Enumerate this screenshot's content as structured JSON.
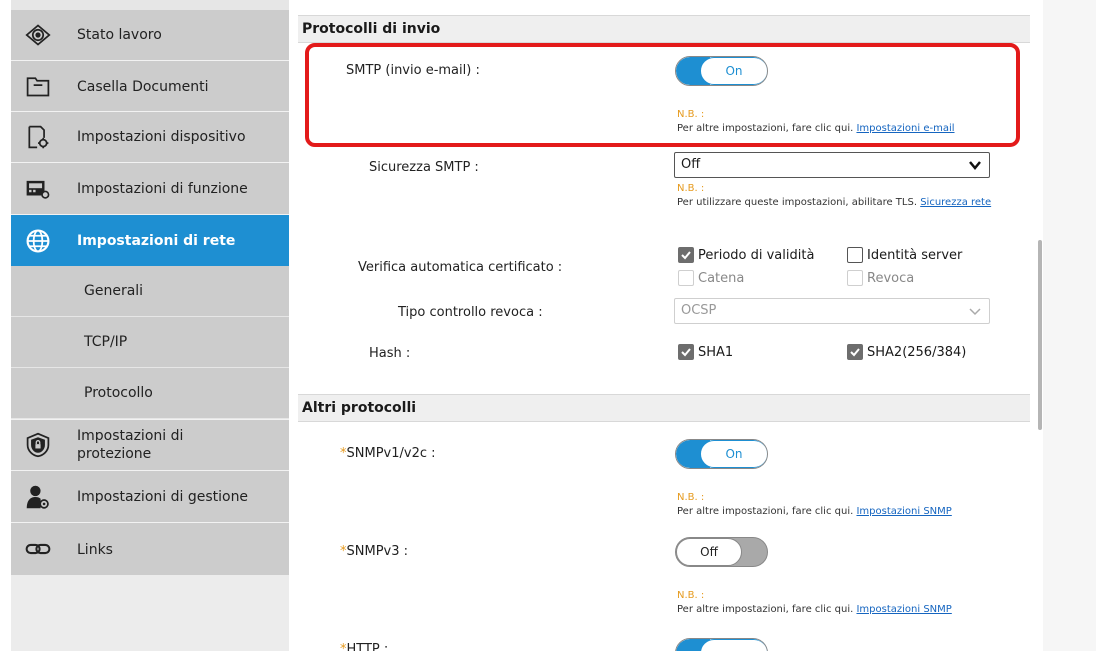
{
  "sidebar": {
    "items": [
      {
        "label": "Stato lavoro",
        "icon": "eye-icon"
      },
      {
        "label": "Casella Documenti",
        "icon": "folder-icon"
      },
      {
        "label": "Impostazioni dispositivo",
        "icon": "device-settings-icon"
      },
      {
        "label": "Impostazioni di funzione",
        "icon": "function-settings-icon"
      },
      {
        "label": "Impostazioni di rete",
        "icon": "globe-icon"
      },
      {
        "label": "Generali"
      },
      {
        "label": "TCP/IP"
      },
      {
        "label": "Protocollo"
      },
      {
        "label": "Impostazioni di protezione",
        "icon": "shield-icon"
      },
      {
        "label": "Impostazioni di gestione",
        "icon": "admin-user-icon"
      },
      {
        "label": "Links",
        "icon": "link-icon"
      }
    ]
  },
  "send_protocols": {
    "header": "Protocolli di invio",
    "smtp": {
      "label": "SMTP (invio e-mail) :",
      "state": "On",
      "note_label": "N.B. :",
      "note_text": "Per altre impostazioni, fare clic qui.",
      "note_link": "Impostazioni e-mail"
    },
    "smtp_security": {
      "label": "Sicurezza SMTP :",
      "value": "Off",
      "note_label": "N.B. :",
      "note_text": "Per utilizzare queste impostazioni, abilitare TLS.",
      "note_link": "Sicurezza rete"
    },
    "cert_check": {
      "label": "Verifica automatica certificato :",
      "options": [
        {
          "label": "Periodo di validità",
          "checked": true,
          "disabled": false
        },
        {
          "label": "Identità server",
          "checked": false,
          "disabled": false
        },
        {
          "label": "Catena",
          "checked": false,
          "disabled": true
        },
        {
          "label": "Revoca",
          "checked": false,
          "disabled": true
        }
      ]
    },
    "revocation_type": {
      "label": "Tipo controllo revoca :",
      "value": "OCSP"
    },
    "hash": {
      "label": "Hash :",
      "options": [
        {
          "label": "SHA1",
          "checked": true
        },
        {
          "label": "SHA2(256/384)",
          "checked": true
        }
      ]
    }
  },
  "other_protocols": {
    "header": "Altri protocolli",
    "snmpv1": {
      "asterisk": "*",
      "label": "SNMPv1/v2c :",
      "state": "On",
      "note_label": "N.B. :",
      "note_text": "Per altre impostazioni, fare clic qui.",
      "note_link": "Impostazioni SNMP"
    },
    "snmpv3": {
      "asterisk": "*",
      "label": "SNMPv3 :",
      "state": "Off",
      "note_label": "N.B. :",
      "note_text": "Per altre impostazioni, fare clic qui.",
      "note_link": "Impostazioni SNMP"
    },
    "http": {
      "asterisk": "*",
      "label": "HTTP :"
    }
  },
  "colors": {
    "accent": "#1e8fd2",
    "highlight": "#e31a1a",
    "note_label": "#e69a1e"
  }
}
